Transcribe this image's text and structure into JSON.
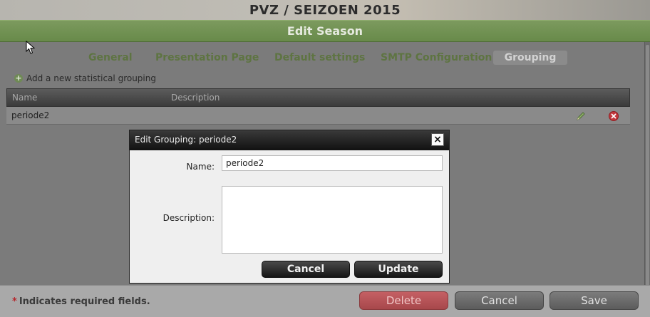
{
  "app": {
    "title": "PVZ / SEIZOEN 2015",
    "section_title": "Edit Season"
  },
  "tabs": [
    {
      "label": "General"
    },
    {
      "label": "Presentation Page"
    },
    {
      "label": "Default settings"
    },
    {
      "label": "SMTP Configuration"
    },
    {
      "label": "Grouping",
      "active": true
    }
  ],
  "add_link": {
    "label": "Add a new statistical grouping",
    "icon": "add-circle-icon"
  },
  "grid": {
    "columns": [
      "Name",
      "Description"
    ],
    "rows": [
      {
        "name": "periode2",
        "description": "",
        "actions": [
          "edit-pencil-icon",
          "delete-x-icon"
        ]
      }
    ]
  },
  "dialog": {
    "title": "Edit Grouping: periode2",
    "close_icon": "close-x-icon",
    "name_label": "Name:",
    "name_value": "periode2",
    "description_label": "Description:",
    "description_value": "",
    "cancel_label": "Cancel",
    "update_label": "Update"
  },
  "footer": {
    "required_star": "*",
    "required_note": "Indicates required fields.",
    "delete_label": "Delete",
    "cancel_label": "Cancel",
    "save_label": "Save"
  },
  "colors": {
    "accent_green": "#6f8d52",
    "tab_text": "#5e7442",
    "delete_red": "#b45155"
  }
}
